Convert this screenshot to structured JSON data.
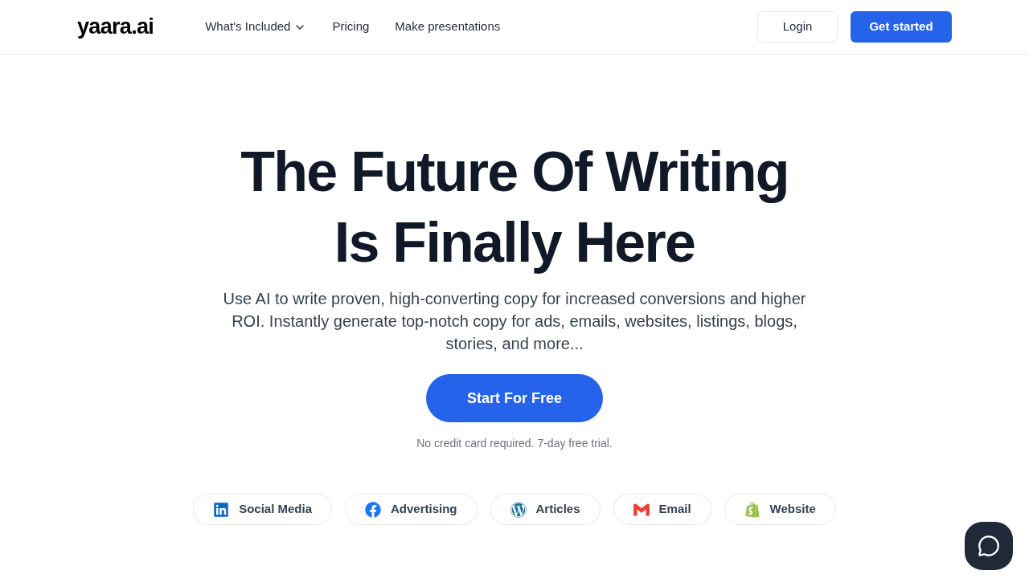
{
  "nav": {
    "logo": "yaara.ai",
    "links": [
      {
        "label": "What's Included",
        "dropdown": true
      },
      {
        "label": "Pricing",
        "dropdown": false
      },
      {
        "label": "Make presentations",
        "dropdown": false
      }
    ],
    "login": "Login",
    "cta": "Get started"
  },
  "hero": {
    "title_lines": [
      "The Future Of Writing",
      "Is Finally Here"
    ],
    "subtitle": "Use AI to write proven, high-converting copy for increased conversions and higher ROI. Instantly generate top-notch copy for ads, emails, websites, listings, blogs, stories, and more...",
    "button": "Start For Free",
    "note": "No credit card required. 7-day free trial."
  },
  "chips": [
    {
      "kind": "linkedin",
      "label": "Social Media"
    },
    {
      "kind": "facebook",
      "label": "Advertising"
    },
    {
      "kind": "wordpress",
      "label": "Articles"
    },
    {
      "kind": "gmail",
      "label": "Email"
    },
    {
      "kind": "shopify",
      "label": "Website"
    }
  ]
}
